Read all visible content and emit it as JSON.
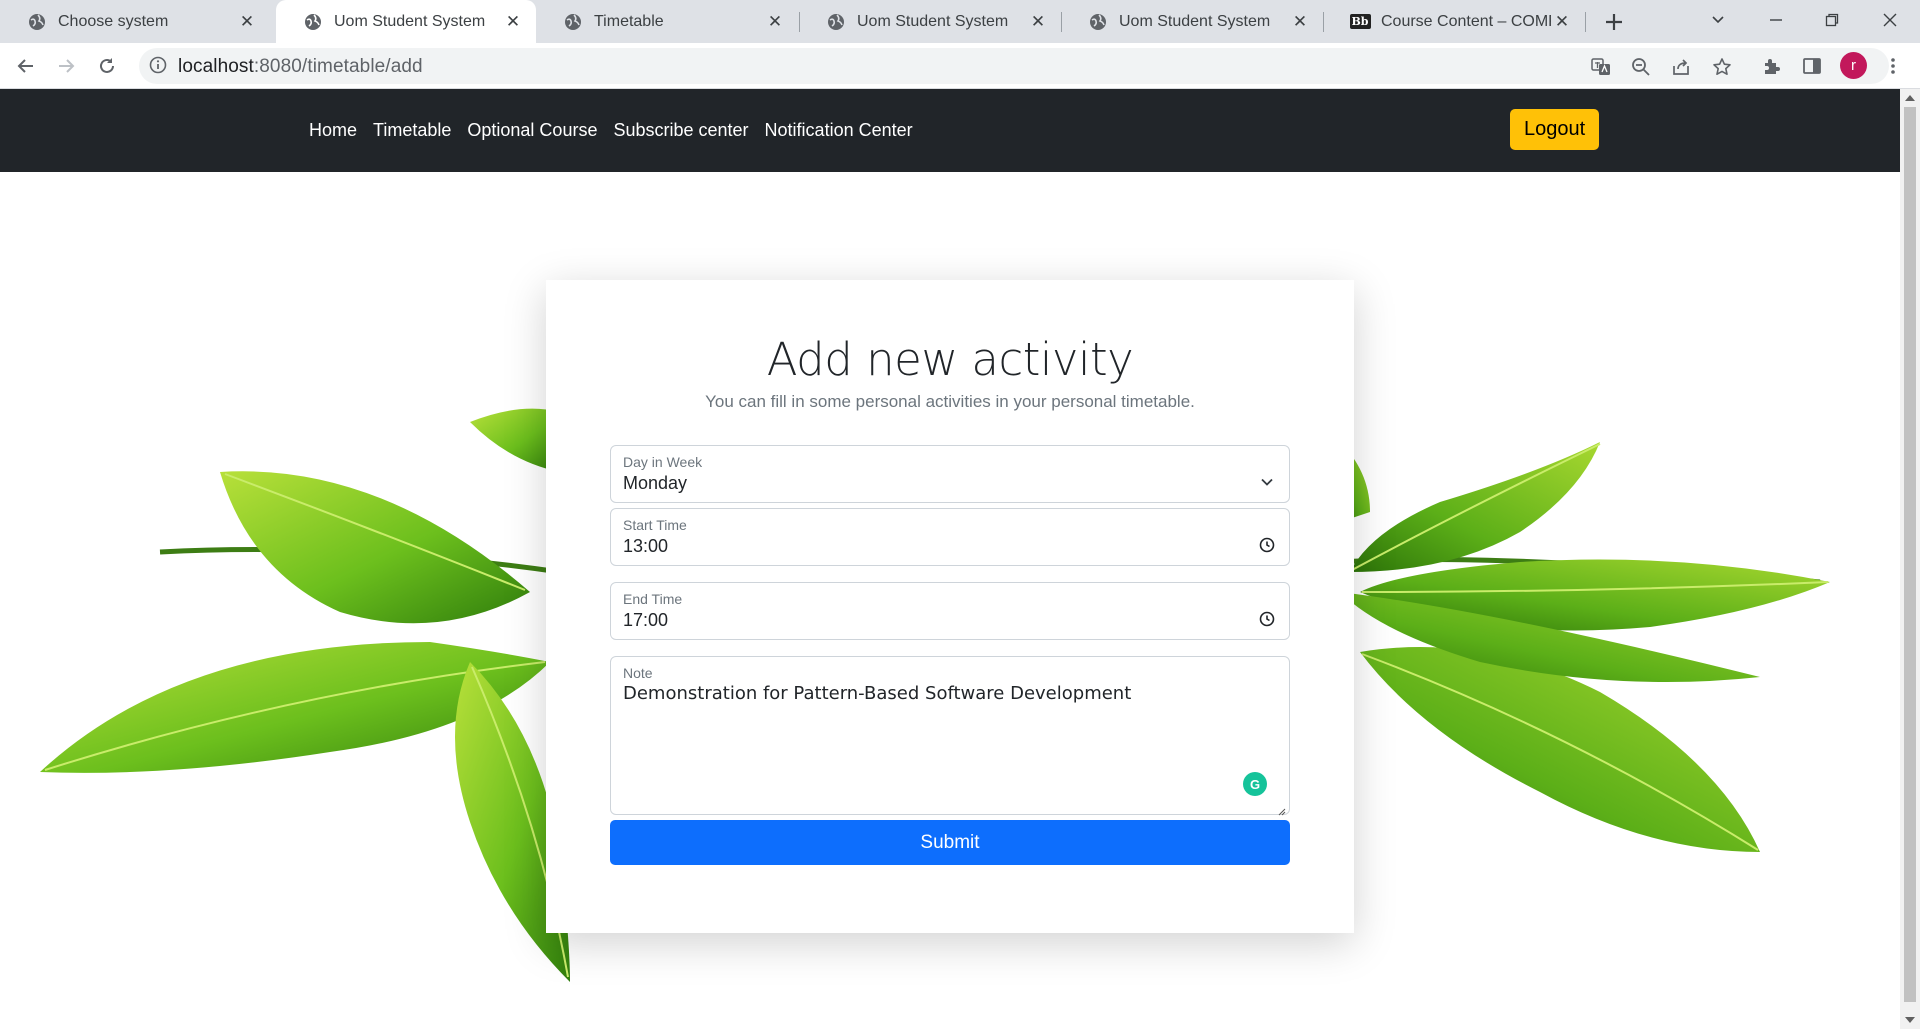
{
  "browser": {
    "tabs": [
      {
        "title": "Choose system",
        "icon": "globe-icon",
        "active": false
      },
      {
        "title": "Uom Student System",
        "icon": "globe-icon",
        "active": true
      },
      {
        "title": "Timetable",
        "icon": "globe-icon",
        "active": false
      },
      {
        "title": "Uom Student System",
        "icon": "globe-icon",
        "active": false
      },
      {
        "title": "Uom Student System",
        "icon": "globe-icon",
        "active": false
      },
      {
        "title": "Course Content – COMP",
        "icon": "blackboard-icon",
        "active": false
      }
    ],
    "url_host": "localhost",
    "url_rest": ":8080/timetable/add",
    "profile_initial": "r",
    "blackboard_glyph": "Bb"
  },
  "navbar": {
    "links": [
      "Home",
      "Timetable",
      "Optional Course",
      "Subscribe center",
      "Notification Center"
    ],
    "logout_label": "Logout"
  },
  "form": {
    "title": "Add new activity",
    "subtitle": "You can fill in some personal activities in your personal timetable.",
    "day": {
      "label": "Day in Week",
      "value": "Monday"
    },
    "start_time": {
      "label": "Start Time",
      "value": "13:00"
    },
    "end_time": {
      "label": "End Time",
      "value": "17:00"
    },
    "note": {
      "label": "Note",
      "value": "Demonstration for Pattern-Based Software Development"
    },
    "submit_label": "Submit"
  },
  "colors": {
    "navbar_bg": "#212529",
    "logout_bg": "#ffc107",
    "submit_bg": "#0d6efd",
    "leaf_green": "#6cbf1d"
  }
}
